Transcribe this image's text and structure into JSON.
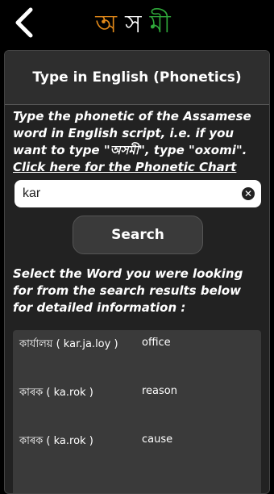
{
  "header": {
    "title_part1": "অ",
    "title_part2": "স",
    "title_part3": "মী",
    "back_icon": "chevron-left-icon"
  },
  "panel": {
    "title": "Type in English (Phonetics)",
    "instructions": "Type the phonetic of the Assamese word in English script, i.e. if you want to type \"অসমী\", type \"oxomi\".",
    "chart_link": "Click here for the Phonetic Chart",
    "search_value": "kar",
    "clear_icon": "clear-icon",
    "search_button": "Search",
    "select_instructions": "Select the Word you were looking for from the search results below for detailed information :"
  },
  "results": [
    {
      "word": "কাৰ্যালয় ( kar.ja.loy )",
      "meaning": "office"
    },
    {
      "word": "কাৰক ( ka.rok )",
      "meaning": "reason"
    },
    {
      "word": "কাৰক ( ka.rok )",
      "meaning": "cause"
    }
  ]
}
